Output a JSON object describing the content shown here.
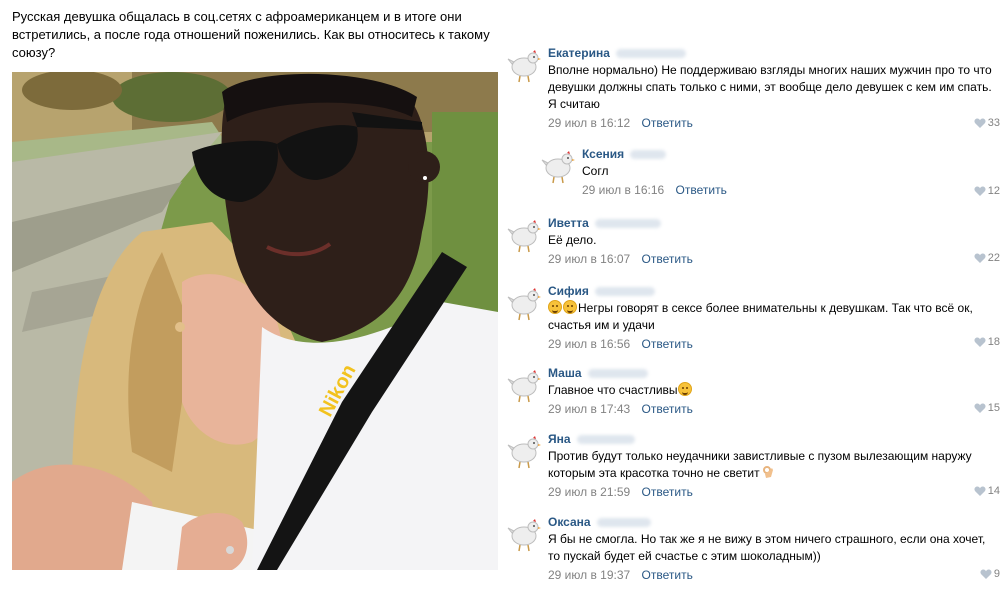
{
  "post": {
    "text": "Русская девушка общалась в соц.сетях с афроамериканцем и в итоге они встретились, а после года отношений поженились. Как вы относитесь к такому союзу?",
    "photo_brand_text": "Nikon"
  },
  "reply_label": "Ответить",
  "comments": [
    {
      "name": "Екатерина",
      "text": "Вполне нормально) Не поддерживаю взгляды многих наших мужчин про то что девушки должны спать только с ними, эт вообще дело девушек с кем им спать. Я считаю",
      "date": "29 июл в 16:12",
      "likes": "33",
      "reply": false
    },
    {
      "name": "Ксения",
      "text": "Согл",
      "date": "29 июл в 16:16",
      "likes": "12",
      "reply": true
    },
    {
      "name": "Иветта",
      "text": "Её дело.",
      "date": "29 июл в 16:07",
      "likes": "22",
      "reply": false
    },
    {
      "name": "Сифия",
      "text": "Негры говорят в сексе более внимательны к девушкам. Так что всё ок, счастья им и удачи",
      "date": "29 июл в 16:56",
      "likes": "18",
      "reply": false
    },
    {
      "name": "Маша",
      "text": "Главное что счастливы",
      "date": "29 июл в 17:43",
      "likes": "15",
      "reply": false
    },
    {
      "name": "Яна",
      "text": "Против будут только неудачники завистливые с пузом вылезающим наружу которым эта красотка точно не светит",
      "date": "29 июл в 21:59",
      "likes": "14",
      "reply": false
    },
    {
      "name": "Оксана",
      "text": "Я бы не смогла. Но так же я не вижу в этом ничего страшного, если она хочет, то пускай будет ей счастье с этим шоколадным))",
      "date": "29 июл в 19:37",
      "likes": "9",
      "reply": false
    }
  ],
  "icons": {
    "avatar": "chicken-icon",
    "like": "heart-icon",
    "emoji": "smile-emoji-icon"
  },
  "colors": {
    "link": "#2a5885",
    "meta": "#828282",
    "text": "#000000"
  }
}
